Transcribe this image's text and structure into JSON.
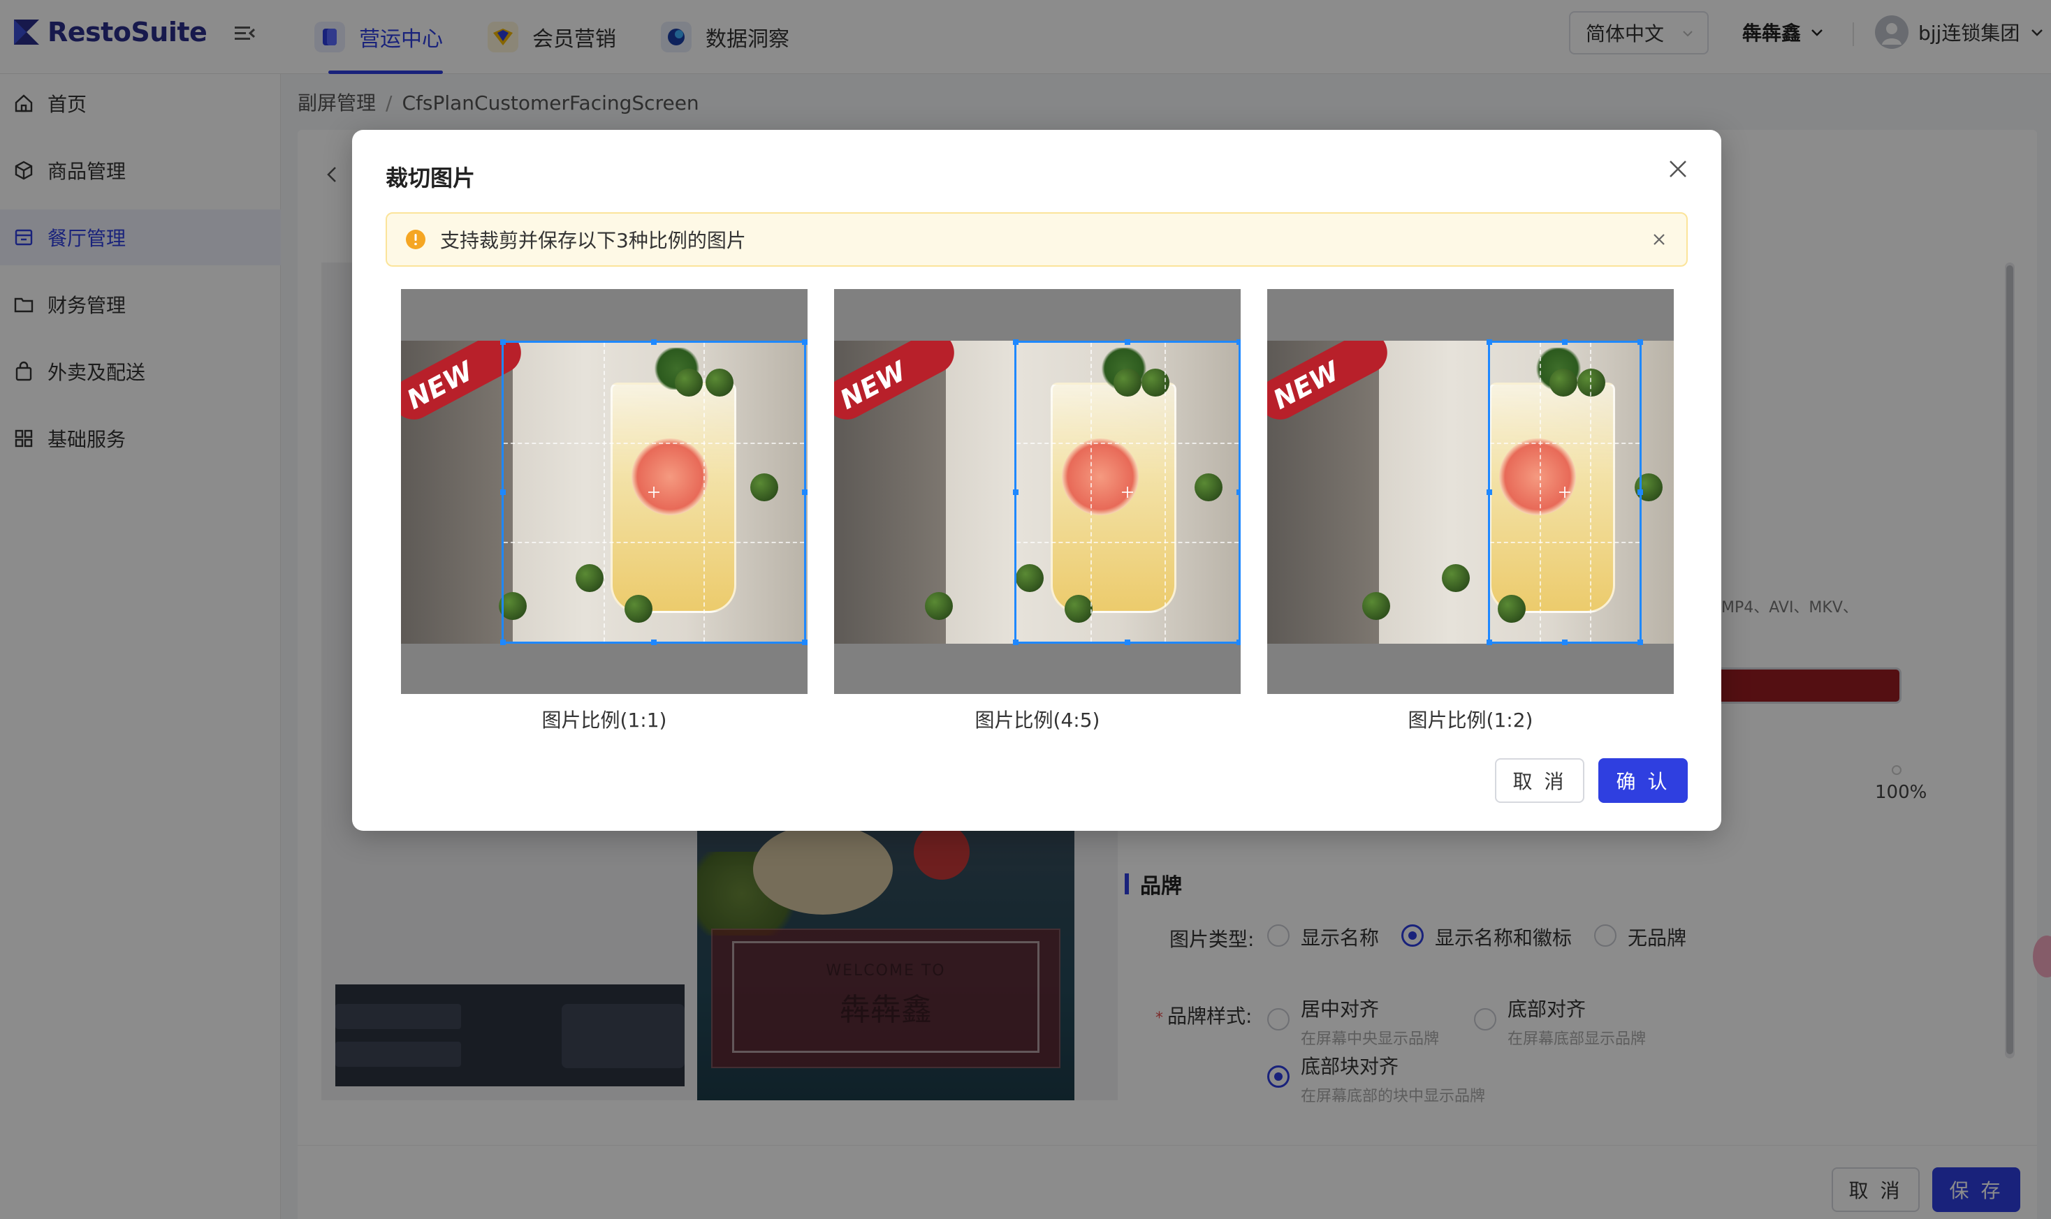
{
  "app": {
    "logo_text": "RestoSuite"
  },
  "header": {
    "tabs": [
      {
        "label": "营运中心",
        "active": true,
        "icon": "operations-icon",
        "color": "#2f3fe0"
      },
      {
        "label": "会员营销",
        "active": false,
        "icon": "member-marketing-icon",
        "color": "#f5b800"
      },
      {
        "label": "数据洞察",
        "active": false,
        "icon": "data-insight-icon",
        "color": "#1a3fa8"
      }
    ],
    "language": "简体中文",
    "brand": "犇犇鑫",
    "user": "bjj连锁集团"
  },
  "sidebar": {
    "items": [
      {
        "label": "首页",
        "icon": "home-icon",
        "active": false
      },
      {
        "label": "商品管理",
        "icon": "product-icon",
        "active": false
      },
      {
        "label": "餐厅管理",
        "icon": "restaurant-icon",
        "active": true
      },
      {
        "label": "财务管理",
        "icon": "finance-icon",
        "active": false
      },
      {
        "label": "外卖及配送",
        "icon": "delivery-icon",
        "active": false
      },
      {
        "label": "基础服务",
        "icon": "basic-service-icon",
        "active": false
      }
    ]
  },
  "breadcrumb": {
    "parent": "副屏管理",
    "current": "CfsPlanCustomerFacingScreen"
  },
  "background_form": {
    "formats_text": "MP4、AVI、MKV、",
    "opacity_value": "100%",
    "section_title": "品牌",
    "image_type_label": "图片类型:",
    "image_type_options": [
      {
        "label": "显示名称",
        "checked": false
      },
      {
        "label": "显示名称和徽标",
        "checked": true
      },
      {
        "label": "无品牌",
        "checked": false
      }
    ],
    "brand_style_label": "品牌样式:",
    "brand_style_options": [
      {
        "label": "居中对齐",
        "desc": "在屏幕中央显示品牌",
        "checked": false
      },
      {
        "label": "底部对齐",
        "desc": "在屏幕底部显示品牌",
        "checked": false
      },
      {
        "label": "底部块对齐",
        "desc": "在屏幕底部的块中显示品牌",
        "checked": true
      }
    ],
    "preview_welcome": "WELCOME TO",
    "preview_brand": "犇犇鑫"
  },
  "footer": {
    "cancel_label": "取 消",
    "save_label": "保 存"
  },
  "modal": {
    "title": "裁切图片",
    "alert_text": "支持裁剪并保存以下3种比例的图片",
    "photo_badge": "NEW",
    "crops": [
      {
        "caption": "图片比例(1:1)",
        "ratio": "1:1"
      },
      {
        "caption": "图片比例(4:5)",
        "ratio": "4:5"
      },
      {
        "caption": "图片比例(1:2)",
        "ratio": "1:2"
      }
    ],
    "cancel_label": "取 消",
    "confirm_label": "确 认"
  },
  "colors": {
    "primary": "#2f3fe0",
    "crop_frame": "#1e88ff",
    "alert_bg": "#fef9e6",
    "warning": "#f5a623"
  }
}
